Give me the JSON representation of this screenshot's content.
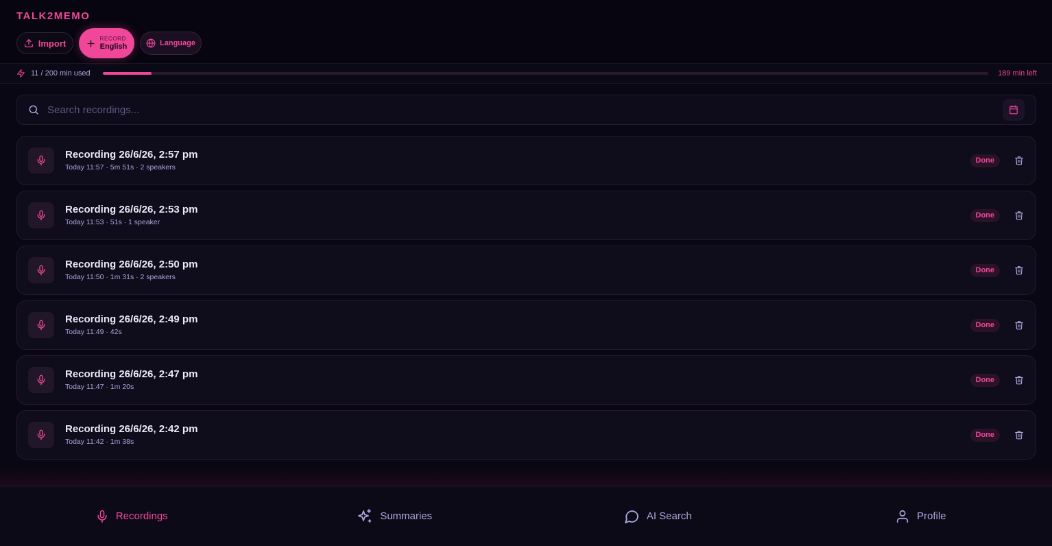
{
  "app": {
    "brand": "TALK2MEMO"
  },
  "toolbar": {
    "import_label": "Import",
    "record_small": "RECORD",
    "record_language": "English",
    "language_label": "Language"
  },
  "usage": {
    "used_text": "11 / 200 min used",
    "left_text": "189 min left",
    "used_fraction": 0.055
  },
  "search": {
    "placeholder": "Search recordings..."
  },
  "recordings": [
    {
      "title": "Recording 26/6/26, 2:57 pm",
      "meta": "Today 11:57 · 5m 51s · 2 speakers",
      "status": "Done"
    },
    {
      "title": "Recording 26/6/26, 2:53 pm",
      "meta": "Today 11:53 · 51s · 1 speaker",
      "status": "Done"
    },
    {
      "title": "Recording 26/6/26, 2:50 pm",
      "meta": "Today 11:50 · 1m 31s · 2 speakers",
      "status": "Done"
    },
    {
      "title": "Recording 26/6/26, 2:49 pm",
      "meta": "Today 11:49 · 42s",
      "status": "Done"
    },
    {
      "title": "Recording 26/6/26, 2:47 pm",
      "meta": "Today 11:47 · 1m 20s",
      "status": "Done"
    },
    {
      "title": "Recording 26/6/26, 2:42 pm",
      "meta": "Today 11:42 · 1m 38s",
      "status": "Done"
    }
  ],
  "nav": {
    "recordings": "Recordings",
    "summaries": "Summaries",
    "ai_search": "AI Search",
    "profile": "Profile"
  },
  "colors": {
    "accent": "#f0479a",
    "background": "#090713",
    "muted_text": "#a9a7dc"
  }
}
